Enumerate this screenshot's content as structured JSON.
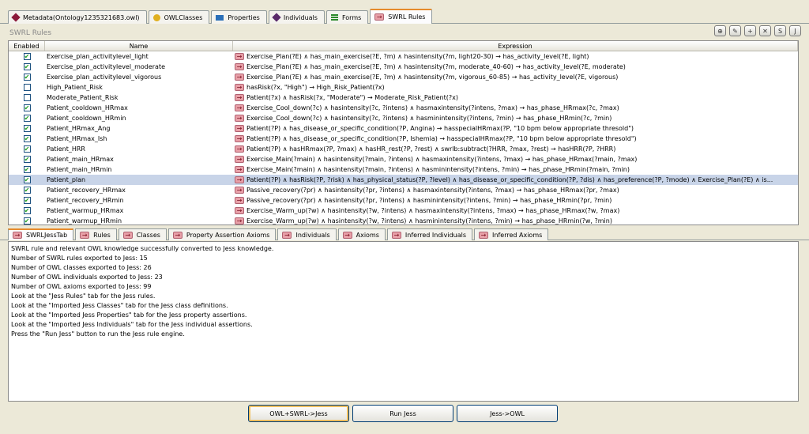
{
  "top_tabs": [
    {
      "label": "Metadata(Ontology1235321683.owl)",
      "icon": "metadata-diamond-icon",
      "color": "#8b1a3a"
    },
    {
      "label": "OWLClasses",
      "icon": "owl-class-circle-icon",
      "color": "#e0b020"
    },
    {
      "label": "Properties",
      "icon": "properties-rect-icon",
      "color": "#2a6fb8"
    },
    {
      "label": "Individuals",
      "icon": "individual-diamond-icon",
      "color": "#5a2a6a"
    },
    {
      "label": "Forms",
      "icon": "forms-icon",
      "color": "#2d8a2d"
    },
    {
      "label": "SWRL Rules",
      "icon": "swrl-arrow-icon",
      "color": "#e8a0a8"
    }
  ],
  "active_top_tab": 5,
  "panel_title": "SWRL Rules",
  "table": {
    "headers": [
      "Enabled",
      "Name",
      "Expression"
    ],
    "rows": [
      {
        "enabled": true,
        "name": "Exercise_plan_activitylevel_light",
        "expr": "Exercise_Plan(?E) ∧ has_main_exercise(?E, ?m) ∧ hasintensity(?m, light20-30) → has_activity_level(?E, light)"
      },
      {
        "enabled": true,
        "name": "Exercise_plan_activitylevel_moderate",
        "expr": "Exercise_Plan(?E) ∧ has_main_exercise(?E, ?m) ∧ hasintensity(?m, moderate_40-60) → has_activity_level(?E, moderate)"
      },
      {
        "enabled": true,
        "name": "Exercise_plan_activitylevel_vigorous",
        "expr": "Exercise_Plan(?E) ∧ has_main_exercise(?E, ?m) ∧ hasintensity(?m, vigorous_60-85) → has_activity_level(?E, vigorous)"
      },
      {
        "enabled": false,
        "name": "High_Patient_Risk",
        "expr": "hasRisk(?x, \"High\") → High_Risk_Patient(?x)"
      },
      {
        "enabled": false,
        "name": "Moderate_Patient_Risk",
        "expr": "Patient(?x) ∧ hasRisk(?x, \"Moderate\") → Moderate_Risk_Patient(?x)"
      },
      {
        "enabled": true,
        "name": "Patient_cooldown_HRmax",
        "expr": "Exercise_Cool_down(?c) ∧ hasintensity(?c, ?intens) ∧ hasmaxintensity(?intens, ?max) → has_phase_HRmax(?c, ?max)"
      },
      {
        "enabled": true,
        "name": "Patient_cooldown_HRmin",
        "expr": "Exercise_Cool_down(?c) ∧ hasintensity(?c, ?intens) ∧ hasminintensity(?intens, ?min) → has_phase_HRmin(?c, ?min)"
      },
      {
        "enabled": true,
        "name": "Patient_HRmax_Ang",
        "expr": "Patient(?P) ∧ has_disease_or_specific_condition(?P, Angina) → hasspecialHRmax(?P, \"10 bpm below appropriate thresold\")"
      },
      {
        "enabled": true,
        "name": "Patient_HRmax_Ish",
        "expr": "Patient(?P) ∧ has_disease_or_specific_condition(?P, Ishemia) → hasspecialHRmax(?P, \"10 bpm below appropriate thresold\")"
      },
      {
        "enabled": true,
        "name": "Patient_HRR",
        "expr": "Patient(?P) ∧ hasHRmax(?P, ?max) ∧ hasHR_rest(?P, ?rest) ∧ swrlb:subtract(?HRR, ?max, ?rest) → hasHRR(?P, ?HRR)"
      },
      {
        "enabled": true,
        "name": "Patient_main_HRmax",
        "expr": "Exercise_Main(?main) ∧ hasintensity(?main, ?intens) ∧ hasmaxintensity(?intens, ?max) → has_phase_HRmax(?main, ?max)"
      },
      {
        "enabled": true,
        "name": "Patient_main_HRmin",
        "expr": "Exercise_Main(?main) ∧ hasintensity(?main, ?intens) ∧ hasminintensity(?intens, ?min) → has_phase_HRmin(?main, ?min)"
      },
      {
        "enabled": true,
        "name": "Patient_plan",
        "expr": "Patient(?P) ∧ hasRisk(?P, ?risk) ∧ has_physical_status(?P, ?level) ∧ has_disease_or_specific_condition(?P, ?dis) ∧ has_preference(?P, ?mode) ∧ Exercise_Plan(?E) ∧ is...",
        "selected": true
      },
      {
        "enabled": true,
        "name": "Patient_recovery_HRmax",
        "expr": "Passive_recovery(?pr) ∧ hasintensity(?pr, ?intens) ∧ hasmaxintensity(?intens, ?max) → has_phase_HRmax(?pr, ?max)"
      },
      {
        "enabled": true,
        "name": "Patient_recovery_HRmin",
        "expr": "Passive_recovery(?pr) ∧ hasintensity(?pr, ?intens) ∧ hasminintensity(?intens, ?min) → has_phase_HRmin(?pr, ?min)"
      },
      {
        "enabled": true,
        "name": "Patient_warmup_HRmax",
        "expr": "Exercise_Warm_up(?w) ∧ hasintensity(?w, ?intens) ∧ hasmaxintensity(?intens, ?max) → has_phase_HRmax(?w, ?max)"
      },
      {
        "enabled": true,
        "name": "Patient_warmup_HRmin",
        "expr": "Exercise_Warm_up(?w) ∧ hasintensity(?w, ?intens) ∧ hasminintensity(?intens, ?min) → has_phase_HRmin(?w, ?min)"
      }
    ]
  },
  "bottom_tabs": [
    "SWRLJessTab",
    "Rules",
    "Classes",
    "Property Assertion Axioms",
    "Individuals",
    "Axioms",
    "Inferred Individuals",
    "Inferred Axioms"
  ],
  "active_bottom_tab": 0,
  "console_lines": [
    "SWRL rule and relevant OWL knowledge successfully converted to Jess knowledge.",
    "Number of SWRL rules exported to Jess: 15",
    "Number of OWL classes exported to Jess: 26",
    "Number of OWL individuals exported to Jess: 23",
    "Number of OWL axioms exported to Jess: 99",
    "Look at the \"Jess Rules\" tab for the Jess rules.",
    "Look at the \"Imported Jess Classes\" tab for the Jess class definitions.",
    "Look at the \"Imported Jess Properties\" tab for the Jess property assertions.",
    "Look at the \"Imported Jess Individuals\" tab for the Jess individual assertions.",
    "Press the \"Run Jess\" button to run the Jess rule engine."
  ],
  "buttons": {
    "owl_to_jess": "OWL+SWRL->Jess",
    "run_jess": "Run Jess",
    "jess_to_owl": "Jess->OWL"
  },
  "toolbar_icons": [
    "create-rule-icon",
    "edit-rule-icon",
    "add-rule-icon",
    "delete-rule-icon",
    "swrl-tab-icon",
    "jess-icon"
  ],
  "toolbar_glyphs": [
    "⊕",
    "✎",
    "+",
    "✕",
    "S",
    "J"
  ],
  "accent_color": "#e68b2c",
  "checkmark": "✔"
}
